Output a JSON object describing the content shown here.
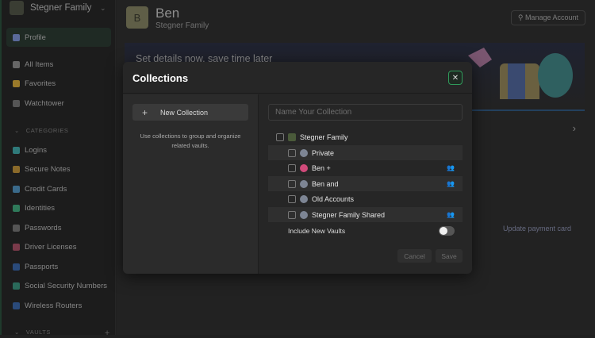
{
  "sidebar": {
    "account": "Stegner Family",
    "profile": "Profile",
    "items": [
      "All Items",
      "Favorites",
      "Watchtower"
    ],
    "categories_label": "CATEGORIES",
    "categories": [
      "Logins",
      "Secure Notes",
      "Credit Cards",
      "Identities",
      "Passwords",
      "Driver Licenses",
      "Passports",
      "Social Security Numbers",
      "Wireless Routers"
    ],
    "vaults_label": "VAULTS"
  },
  "main": {
    "avatar_letter": "B",
    "user_name": "Ben",
    "user_sub": "Stegner Family",
    "manage": "Manage Account",
    "banner": "Set details now, save time later",
    "update_card": "Update payment card"
  },
  "modal": {
    "title": "Collections",
    "new_collection": "New Collection",
    "hint": "Use collections to group and organize related vaults.",
    "name_placeholder": "Name Your Collection",
    "parent": "Stegner Family",
    "vaults": [
      {
        "name": "Private",
        "shared": false
      },
      {
        "name": "Ben +",
        "shared": true
      },
      {
        "name": "Ben and",
        "shared": true
      },
      {
        "name": "Old Accounts",
        "shared": false
      },
      {
        "name": "Stegner Family Shared",
        "shared": true
      }
    ],
    "include_new": "Include New Vaults",
    "include_new_on": false,
    "cancel": "Cancel",
    "save": "Save"
  }
}
